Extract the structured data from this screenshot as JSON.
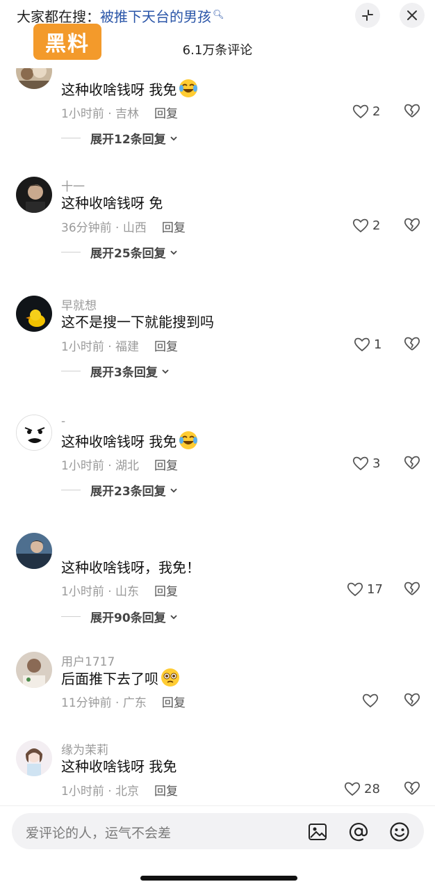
{
  "header": {
    "search_prefix": "大家都在搜：",
    "search_keyword": "被推下天台的男孩",
    "logo_text": "黑料",
    "comment_count_title": "6.1万条评论",
    "shrink_icon": "collapse-icon",
    "close_icon": "close-icon"
  },
  "comments": [
    {
      "name": "",
      "text": "这种收啥钱呀 我免",
      "emoji": "laughing-tears",
      "time": "1小时前",
      "location": "吉林",
      "reply": "回复",
      "likes": "2",
      "expand": "展开12条回复"
    },
    {
      "name": "十一",
      "text": "这种收啥钱呀 免",
      "emoji": "",
      "time": "36分钟前",
      "location": "山西",
      "reply": "回复",
      "likes": "2",
      "expand": "展开25条回复"
    },
    {
      "name": "早就想",
      "text": "这不是搜一下就能搜到吗",
      "emoji": "",
      "time": "1小时前",
      "location": "福建",
      "reply": "回复",
      "likes": "1",
      "expand": "展开3条回复"
    },
    {
      "name": "-",
      "text": "这种收啥钱呀 我免",
      "emoji": "laughing-tears",
      "time": "1小时前",
      "location": "湖北",
      "reply": "回复",
      "likes": "3",
      "expand": "展开23条回复"
    },
    {
      "name": "",
      "text": "这种收啥钱呀，我免！",
      "emoji": "",
      "time": "1小时前",
      "location": "山东",
      "reply": "回复",
      "likes": "17",
      "expand": "展开90条回复"
    },
    {
      "name": "用户1717",
      "text": "后面推下去了呗",
      "emoji": "pleading-face",
      "time": "11分钟前",
      "location": "广东",
      "reply": "回复",
      "likes": "",
      "expand": ""
    },
    {
      "name": "缘为茉莉",
      "text": "这种收啥钱呀 我免",
      "emoji": "",
      "time": "1小时前",
      "location": "北京",
      "reply": "回复",
      "likes": "28",
      "expand": ""
    }
  ],
  "composer": {
    "placeholder": "爱评论的人，运气不会差",
    "icons": [
      "image-icon",
      "mention-icon",
      "emoji-icon"
    ]
  },
  "colors": {
    "logo_bg": "#f39a2b",
    "keyword": "#2a55a8"
  }
}
